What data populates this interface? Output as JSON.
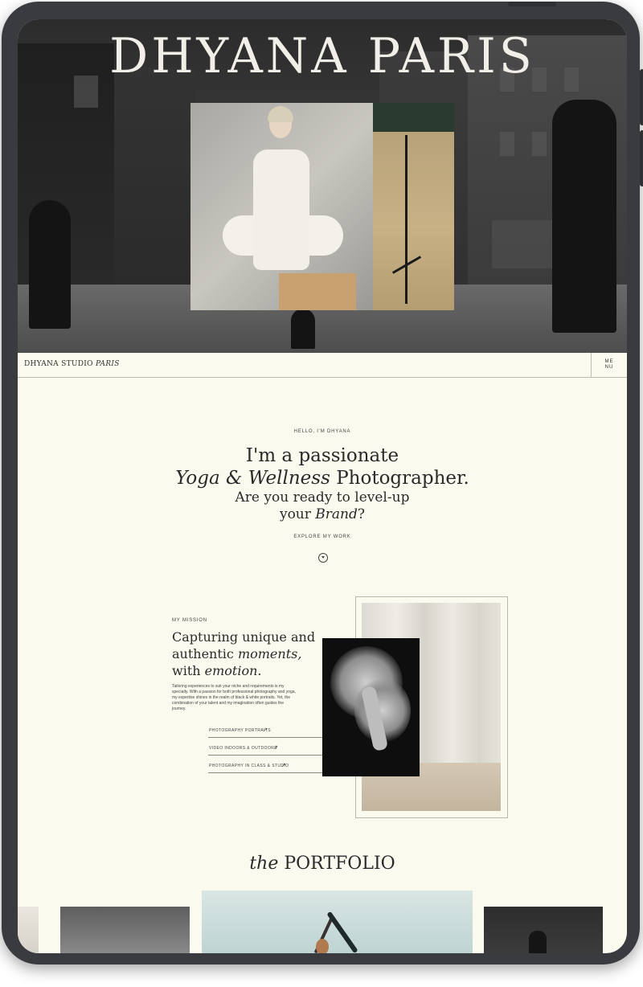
{
  "hero": {
    "title": "DHYANA PARIS"
  },
  "nav": {
    "brand_main": "DHYANA STUDIO",
    "brand_italic": "PARIS",
    "menu_top": "ME",
    "menu_bottom": "NU"
  },
  "intro": {
    "eyebrow": "HELLO, I'M DHYANA",
    "line1": "I'm a passionate",
    "line2_italic": "Yoga & Wellness",
    "line2_rest": " Photographer.",
    "line3": "Are you ready to level-up",
    "line4_pre": "your ",
    "line4_italic": "Brand",
    "line4_post": "?",
    "cta": "EXPLORE MY WORK"
  },
  "mission": {
    "eyebrow": "MY MISSION",
    "heading_line1": "Capturing unique and",
    "heading_line2_pre": "authentic ",
    "heading_line2_italic": "moments,",
    "heading_line3_pre": "with ",
    "heading_line3_italic": "emotion.",
    "paragraph": "Tailoring experiences to suit your niche and requirements is my specialty. With a passion for both professional photography and yoga, my expertise shines in the realm of black & white portraits. Yet, the combination of your talent and my imagination often guides the journey.",
    "services": [
      {
        "label": "PHOTOGRAPHY PORTRAITS",
        "arrow": "↗"
      },
      {
        "label": "VIDEO INDOORS & OUTDOORS",
        "arrow": "↗"
      },
      {
        "label": "PHOTOGRAPHY IN CLASS & STUDIO",
        "arrow": "↗"
      }
    ]
  },
  "portfolio": {
    "title_italic": "the",
    "title_rest": " PORTFOLIO"
  },
  "colors": {
    "page_background": "#fbfaef",
    "tablet_frame": "#3a3b3f",
    "text_dark": "#2a2a2a"
  },
  "icons": {
    "scroll_down": "chevron-down-circle-icon",
    "service_link": "arrow-up-right-icon"
  }
}
